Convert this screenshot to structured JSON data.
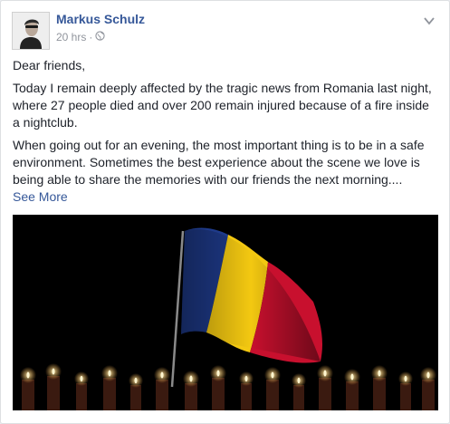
{
  "post": {
    "author": "Markus Schulz",
    "time": "20 hrs",
    "separator": "·",
    "privacy_icon": "globe-icon",
    "menu_icon": "chevron-down-icon",
    "greeting": "Dear friends,",
    "paragraph1": "Today I remain deeply affected by the tragic news from Romania last night, where 27 people died and over 200 remain injured because of a fire inside a nightclub.",
    "paragraph2": "When going out for an evening, the most important thing is to be in a safe environment. Sometimes the best experience about the scene we love is being able to share the memories with our friends the next morning....",
    "see_more": "See More",
    "photo": {
      "flag_colors": [
        "#002b7f",
        "#fcd116",
        "#ce1126"
      ],
      "background": "#000000"
    }
  },
  "colors": {
    "link": "#365899",
    "meta": "#90949c",
    "text": "#1d2129"
  }
}
